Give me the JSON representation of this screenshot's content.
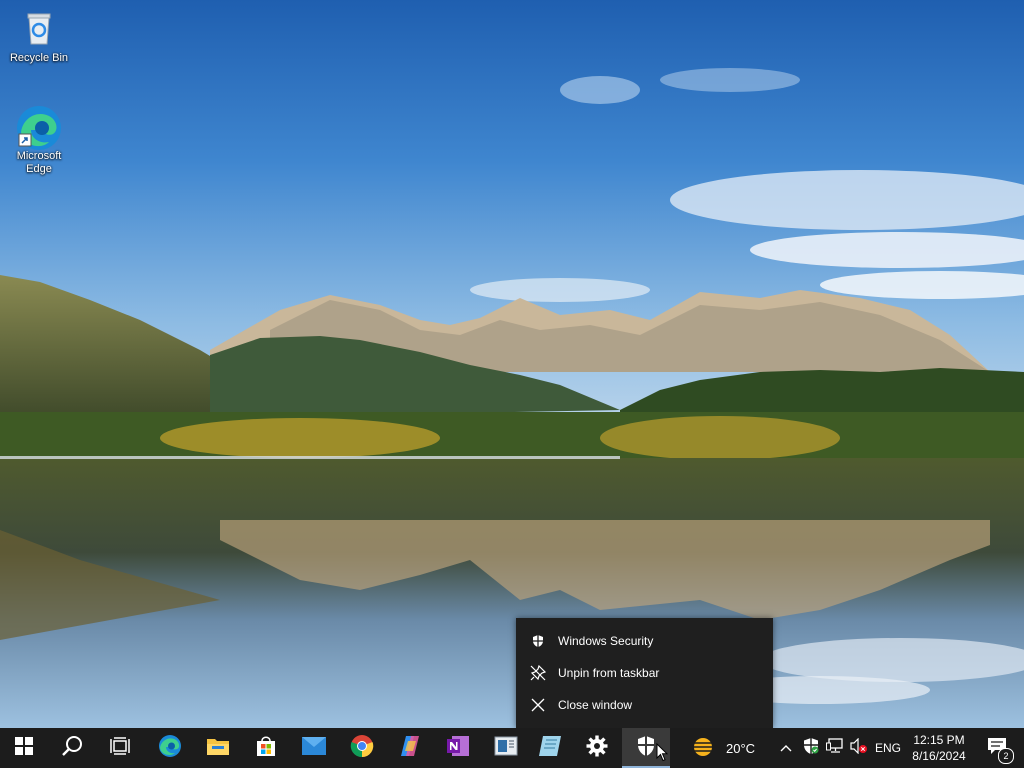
{
  "desktop": {
    "icons": [
      {
        "label": "Recycle Bin",
        "icon": "recycle-bin-icon"
      },
      {
        "label": "Microsoft Edge",
        "icon": "edge-icon"
      }
    ]
  },
  "context_menu": {
    "items": [
      {
        "label": "Windows Security",
        "icon": "shield-icon"
      },
      {
        "label": "Unpin from taskbar",
        "icon": "unpin-icon"
      },
      {
        "label": "Close window",
        "icon": "close-icon"
      }
    ]
  },
  "taskbar": {
    "apps": [
      {
        "name": "Start",
        "icon": "windows-logo-icon"
      },
      {
        "name": "Search",
        "icon": "search-icon"
      },
      {
        "name": "Task View",
        "icon": "task-view-icon"
      },
      {
        "name": "Microsoft Edge",
        "icon": "edge-icon"
      },
      {
        "name": "File Explorer",
        "icon": "folder-icon"
      },
      {
        "name": "Microsoft Store",
        "icon": "store-icon"
      },
      {
        "name": "Mail",
        "icon": "mail-icon"
      },
      {
        "name": "Google Chrome",
        "icon": "chrome-icon"
      },
      {
        "name": "Copilot",
        "icon": "copilot-icon"
      },
      {
        "name": "OneNote",
        "icon": "onenote-icon"
      },
      {
        "name": "Reader",
        "icon": "reader-icon"
      },
      {
        "name": "Notes",
        "icon": "notes-icon"
      },
      {
        "name": "Settings",
        "icon": "gear-icon"
      },
      {
        "name": "Windows Security",
        "icon": "shield-icon",
        "active": true
      }
    ],
    "weather": {
      "temp": "20°C",
      "icon": "sun-haze-icon"
    },
    "tray": {
      "language": "ENG",
      "icons": [
        "chevron-up-icon",
        "defender-icon",
        "network-icon",
        "speaker-muted-icon"
      ]
    },
    "clock": {
      "time": "12:15 PM",
      "date": "8/16/2024"
    },
    "notifications": {
      "count": "2"
    }
  },
  "colors": {
    "taskbar": "#1c1c1c",
    "menu_bg": "#1f1f1f",
    "active_underline": "#8fb4d9"
  }
}
